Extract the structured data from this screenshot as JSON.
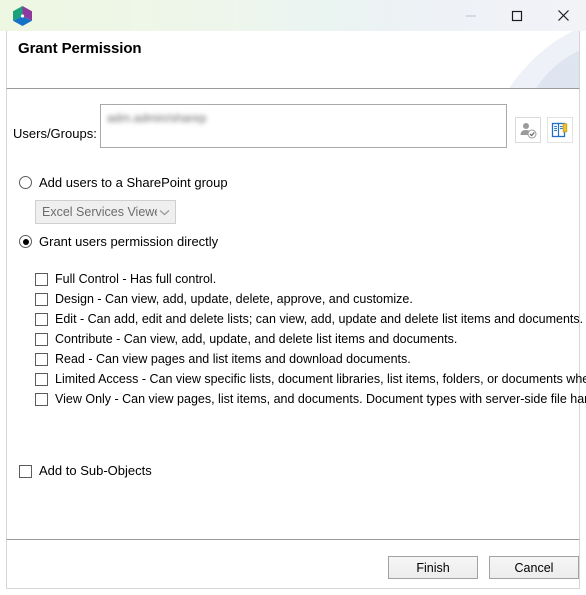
{
  "window": {
    "app_icon_name": "app-cube-icon",
    "controls": {
      "minimize": "—",
      "maximize": "□",
      "close": "✕"
    }
  },
  "header": {
    "title": "Grant Permission"
  },
  "users_groups": {
    "label": "Users/Groups:",
    "value": "adm.admin/sharep",
    "check_names_icon": "check-names-icon",
    "address_book_icon": "address-book-icon"
  },
  "options": {
    "add_to_group": {
      "label": "Add users to a SharePoint group",
      "selected": false
    },
    "group_dropdown": {
      "selected": "Excel Services Viewers",
      "disabled": true,
      "options": [
        "Excel Services Viewers"
      ]
    },
    "grant_directly": {
      "label": "Grant users permission directly",
      "selected": true
    }
  },
  "permissions": [
    {
      "label": "Full Control - Has full control.",
      "checked": false
    },
    {
      "label": "Design - Can view, add, update, delete, approve, and customize.",
      "checked": false
    },
    {
      "label": "Edit - Can add, edit and delete lists; can view, add, update and delete list items and documents.",
      "checked": false
    },
    {
      "label": "Contribute - Can view, add, update, and delete list items and documents.",
      "checked": false
    },
    {
      "label": "Read - Can view pages and list items and download documents.",
      "checked": false
    },
    {
      "label": "Limited Access - Can view specific lists, document libraries, list items, folders, or documents when g",
      "checked": false
    },
    {
      "label": "View Only - Can view pages, list items, and documents. Document types with server-side file handle",
      "checked": false
    }
  ],
  "sub_objects": {
    "label": "Add to Sub-Objects",
    "checked": false
  },
  "footer": {
    "finish_label": "Finish",
    "cancel_label": "Cancel"
  },
  "colors": {
    "titlebar_start": "#eef7e2",
    "titlebar_end": "#f2f3f7",
    "accent_blue": "#1f6fc4",
    "border": "#a9a9a9"
  }
}
